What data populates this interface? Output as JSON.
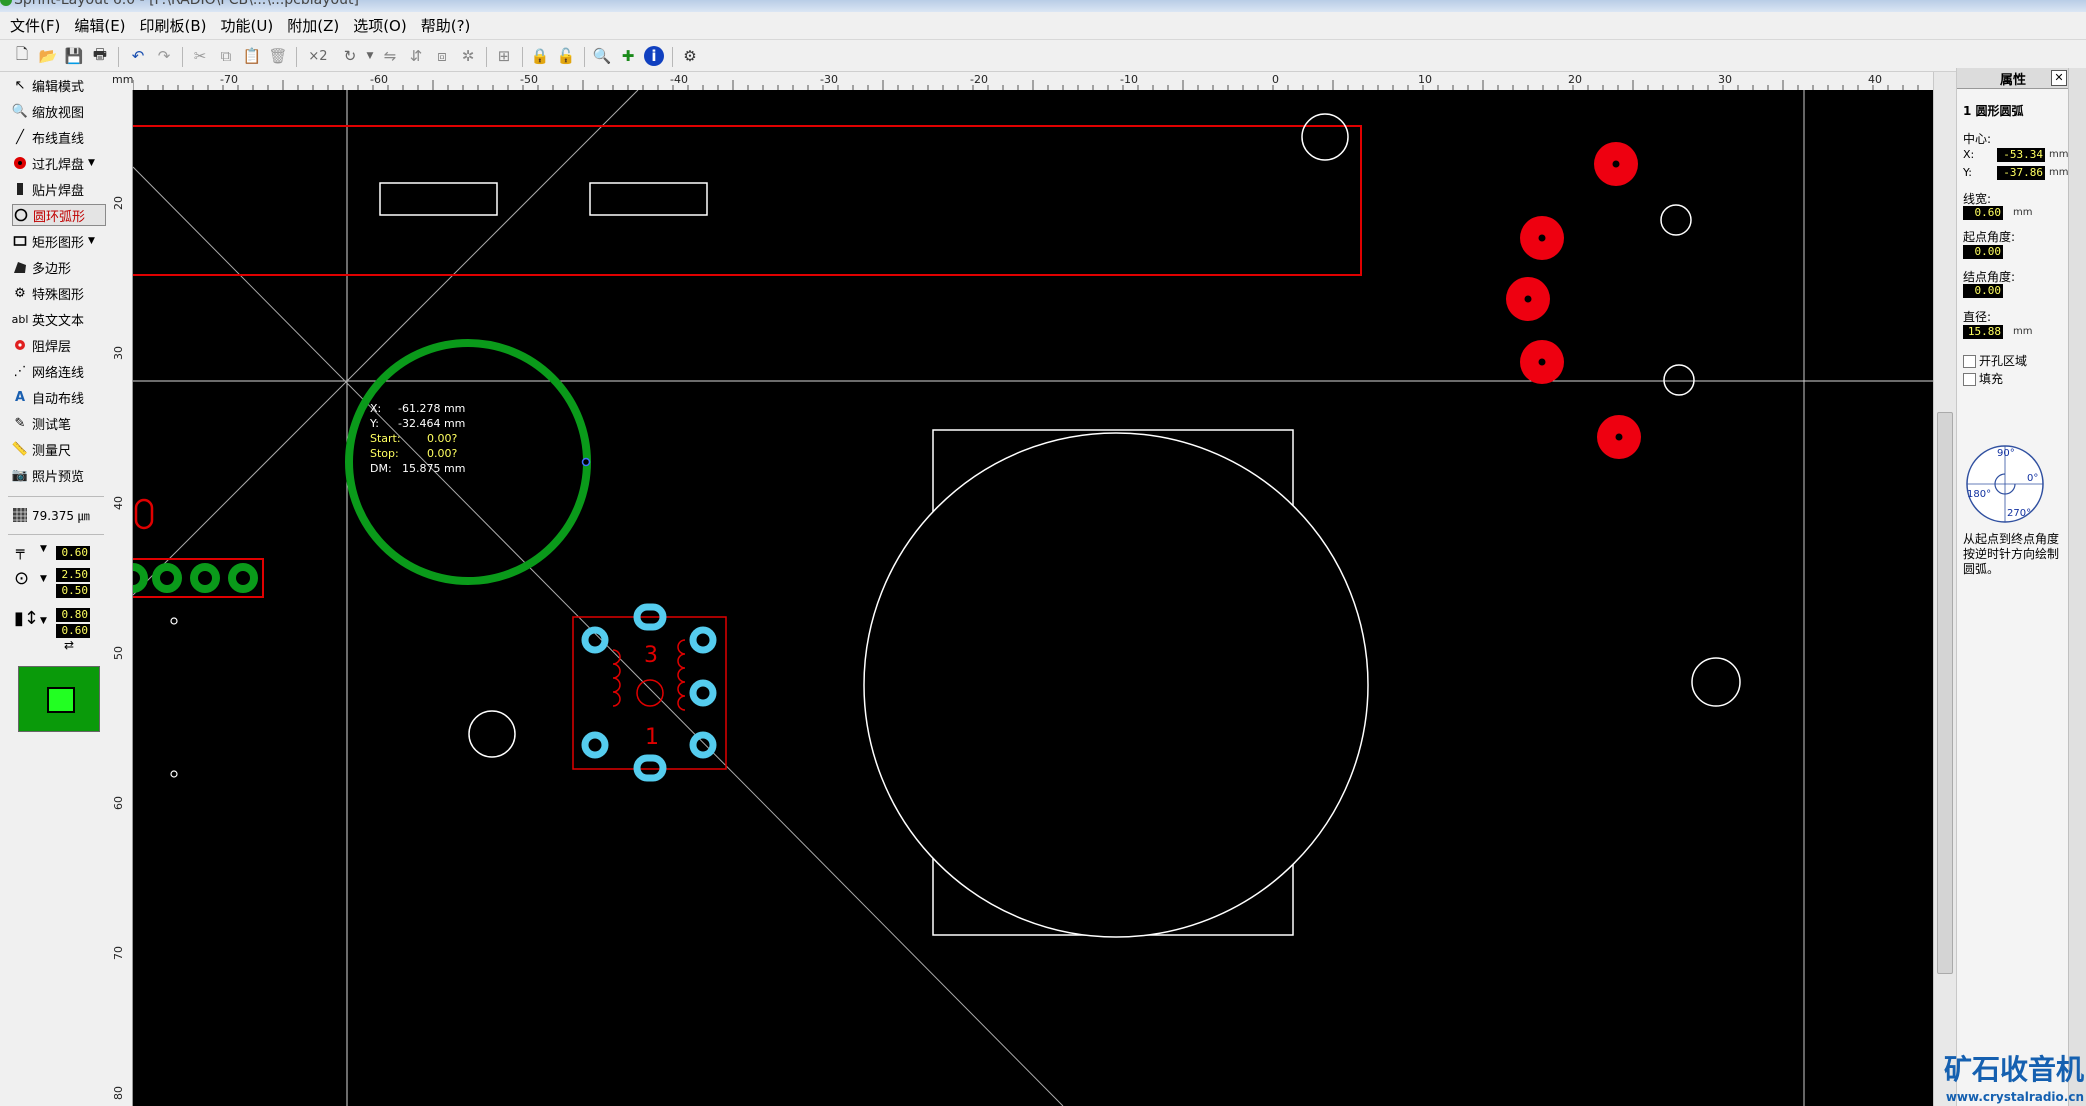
{
  "window": {
    "title": "Sprint-Layout 6.0 - [F:\\RADIO\\PCB\\...\\...pcblayout]"
  },
  "menu": [
    "文件(F)",
    "编辑(E)",
    "印刷板(B)",
    "功能(U)",
    "附加(Z)",
    "选项(O)",
    "帮助(?)"
  ],
  "toolbar": {
    "multiply_label": "×2"
  },
  "tools": [
    {
      "label": "编辑模式",
      "icon": "cursor-icon"
    },
    {
      "label": "缩放视图",
      "icon": "zoom-icon"
    },
    {
      "label": "布线直线",
      "icon": "track-icon"
    },
    {
      "label": "过孔焊盘",
      "icon": "via-pad-icon"
    },
    {
      "label": "贴片焊盘",
      "icon": "smd-pad-icon"
    },
    {
      "label": "圆环弧形",
      "icon": "circle-icon"
    },
    {
      "label": "矩形图形",
      "icon": "rectangle-icon"
    },
    {
      "label": "多边形",
      "icon": "polygon-icon"
    },
    {
      "label": "特殊图形",
      "icon": "special-shape-icon"
    },
    {
      "label": "英文文本",
      "icon": "text-icon"
    },
    {
      "label": "阻焊层",
      "icon": "solder-mask-icon"
    },
    {
      "label": "网络连线",
      "icon": "net-icon"
    },
    {
      "label": "自动布线",
      "icon": "autoroute-icon"
    },
    {
      "label": "测试笔",
      "icon": "test-pen-icon"
    },
    {
      "label": "测量尺",
      "icon": "ruler-icon"
    },
    {
      "label": "照片预览",
      "icon": "photo-preview-icon"
    }
  ],
  "grid": {
    "value": "79.375 ㎛"
  },
  "track_width": "0.60",
  "pad_outer": "2.50",
  "pad_inner": "0.50",
  "smd_w": "0.80",
  "smd_h": "0.60",
  "ruler": {
    "unit": "mm",
    "top": [
      "-70",
      "-60",
      "-50",
      "-40",
      "-30",
      "-20",
      "-10",
      "0",
      "10",
      "20",
      "30",
      "40"
    ],
    "left": [
      "20",
      "30",
      "40",
      "50",
      "60",
      "70",
      "80"
    ]
  },
  "cursor_info": {
    "x_label": "X:",
    "x_value": "-61.278 mm",
    "y_label": "Y:",
    "y_value": "-32.464 mm",
    "start_label": "Start:",
    "start_value": "0.00?",
    "stop_label": "Stop:",
    "stop_value": "0.00?",
    "dm_label": "DM:",
    "dm_value": "15.875 mm"
  },
  "footprint_labels": {
    "pin3": "3",
    "pin1": "1"
  },
  "properties": {
    "header": "属性",
    "close": "✕",
    "object": "1 圆形圆弧",
    "center_label": "中心:",
    "x_label": "X:",
    "x_value": "-53.34",
    "y_label": "Y:",
    "y_value": "-37.86",
    "unit": "mm",
    "width_label": "线宽:",
    "width_value": "0.60",
    "start_label": "起点角度:",
    "start_value": "0.00",
    "end_label": "结点角度:",
    "end_value": "0.00",
    "diameter_label": "直径:",
    "diameter_value": "15.88",
    "cutout_label": "开孔区域",
    "fill_label": "填充",
    "angle_90": "90°",
    "angle_0": "0°",
    "angle_180": "180°",
    "angle_270": "270°",
    "hint": "从起点到终点角度按逆时针方向绘制圆弧。"
  },
  "watermark": {
    "text": "矿石收音机",
    "url": "www.crystalradio.cn"
  },
  "colors": {
    "canvas": "#000000",
    "copper_top": "#e00000",
    "copper_bottom": "#0a9a1a",
    "pad_cyan": "#55ccee",
    "silk": "#ffffff"
  }
}
